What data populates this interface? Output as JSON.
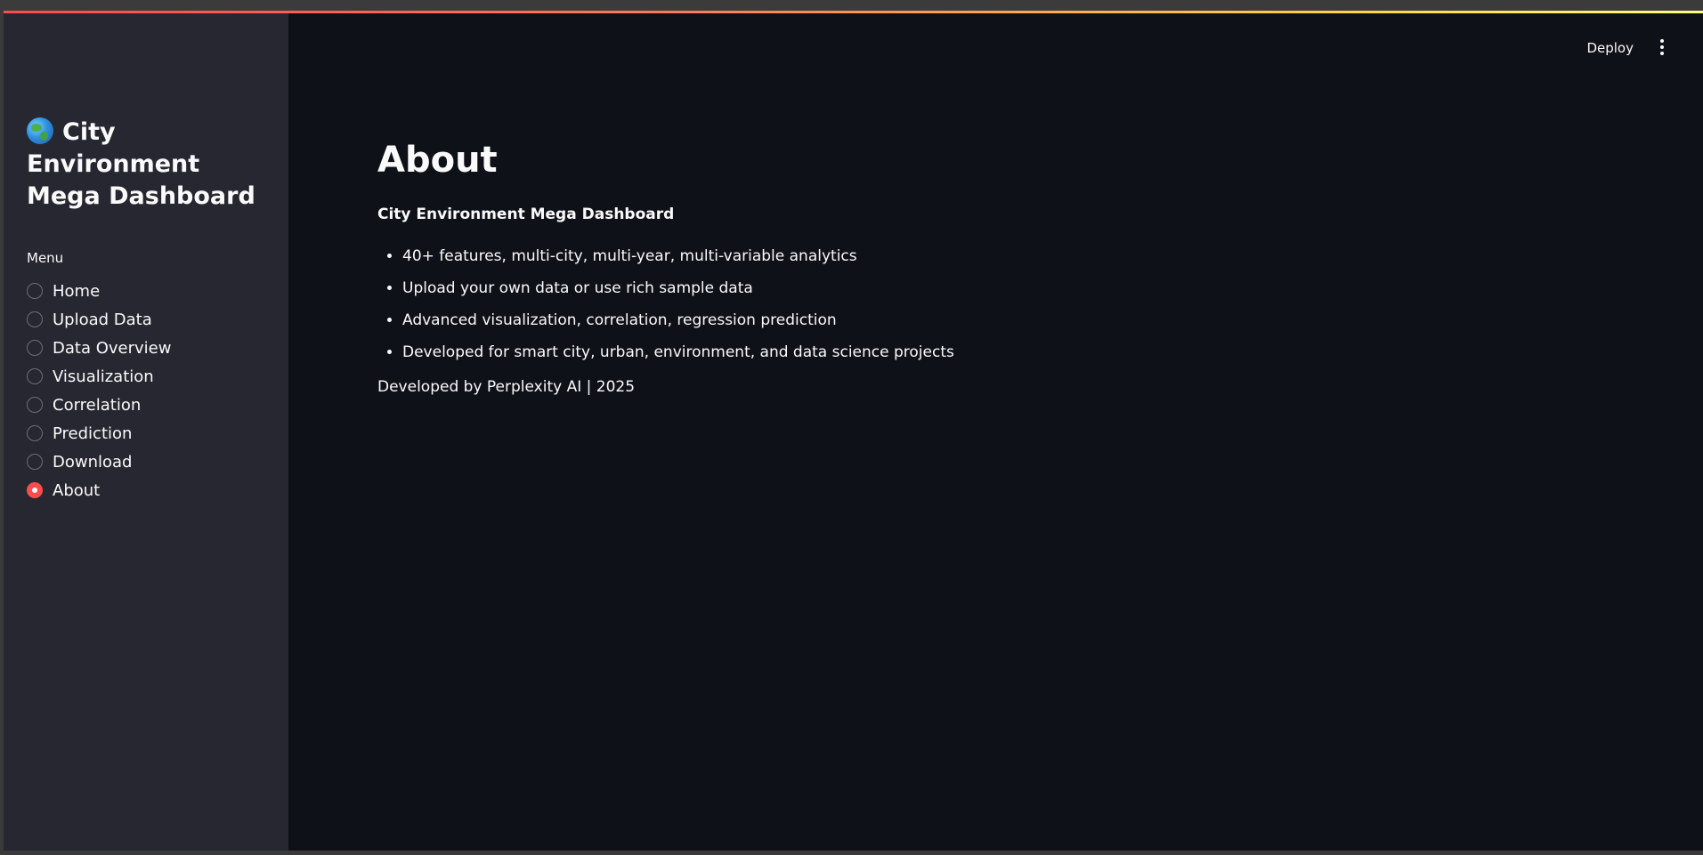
{
  "colors": {
    "accent": "#ff4b4b",
    "background": "#0e1117",
    "sidebar": "#262730",
    "text": "#fafafa"
  },
  "sidebar": {
    "title": "City Environment Mega Dashboard",
    "title_icon": "globe-icon",
    "menu_label": "Menu",
    "items": [
      {
        "label": "Home",
        "selected": false
      },
      {
        "label": "Upload Data",
        "selected": false
      },
      {
        "label": "Data Overview",
        "selected": false
      },
      {
        "label": "Visualization",
        "selected": false
      },
      {
        "label": "Correlation",
        "selected": false
      },
      {
        "label": "Prediction",
        "selected": false
      },
      {
        "label": "Download",
        "selected": false
      },
      {
        "label": "About",
        "selected": true
      }
    ]
  },
  "header": {
    "deploy_label": "Deploy",
    "menu_icon": "kebab-menu-icon"
  },
  "main": {
    "title": "About",
    "subtitle": "City Environment Mega Dashboard",
    "features": [
      "40+ features, multi-city, multi-year, multi-variable analytics",
      "Upload your own data or use rich sample data",
      "Advanced visualization, correlation, regression prediction",
      "Developed for smart city, urban, environment, and data science projects"
    ],
    "credit": "Developed by Perplexity AI | 2025"
  }
}
